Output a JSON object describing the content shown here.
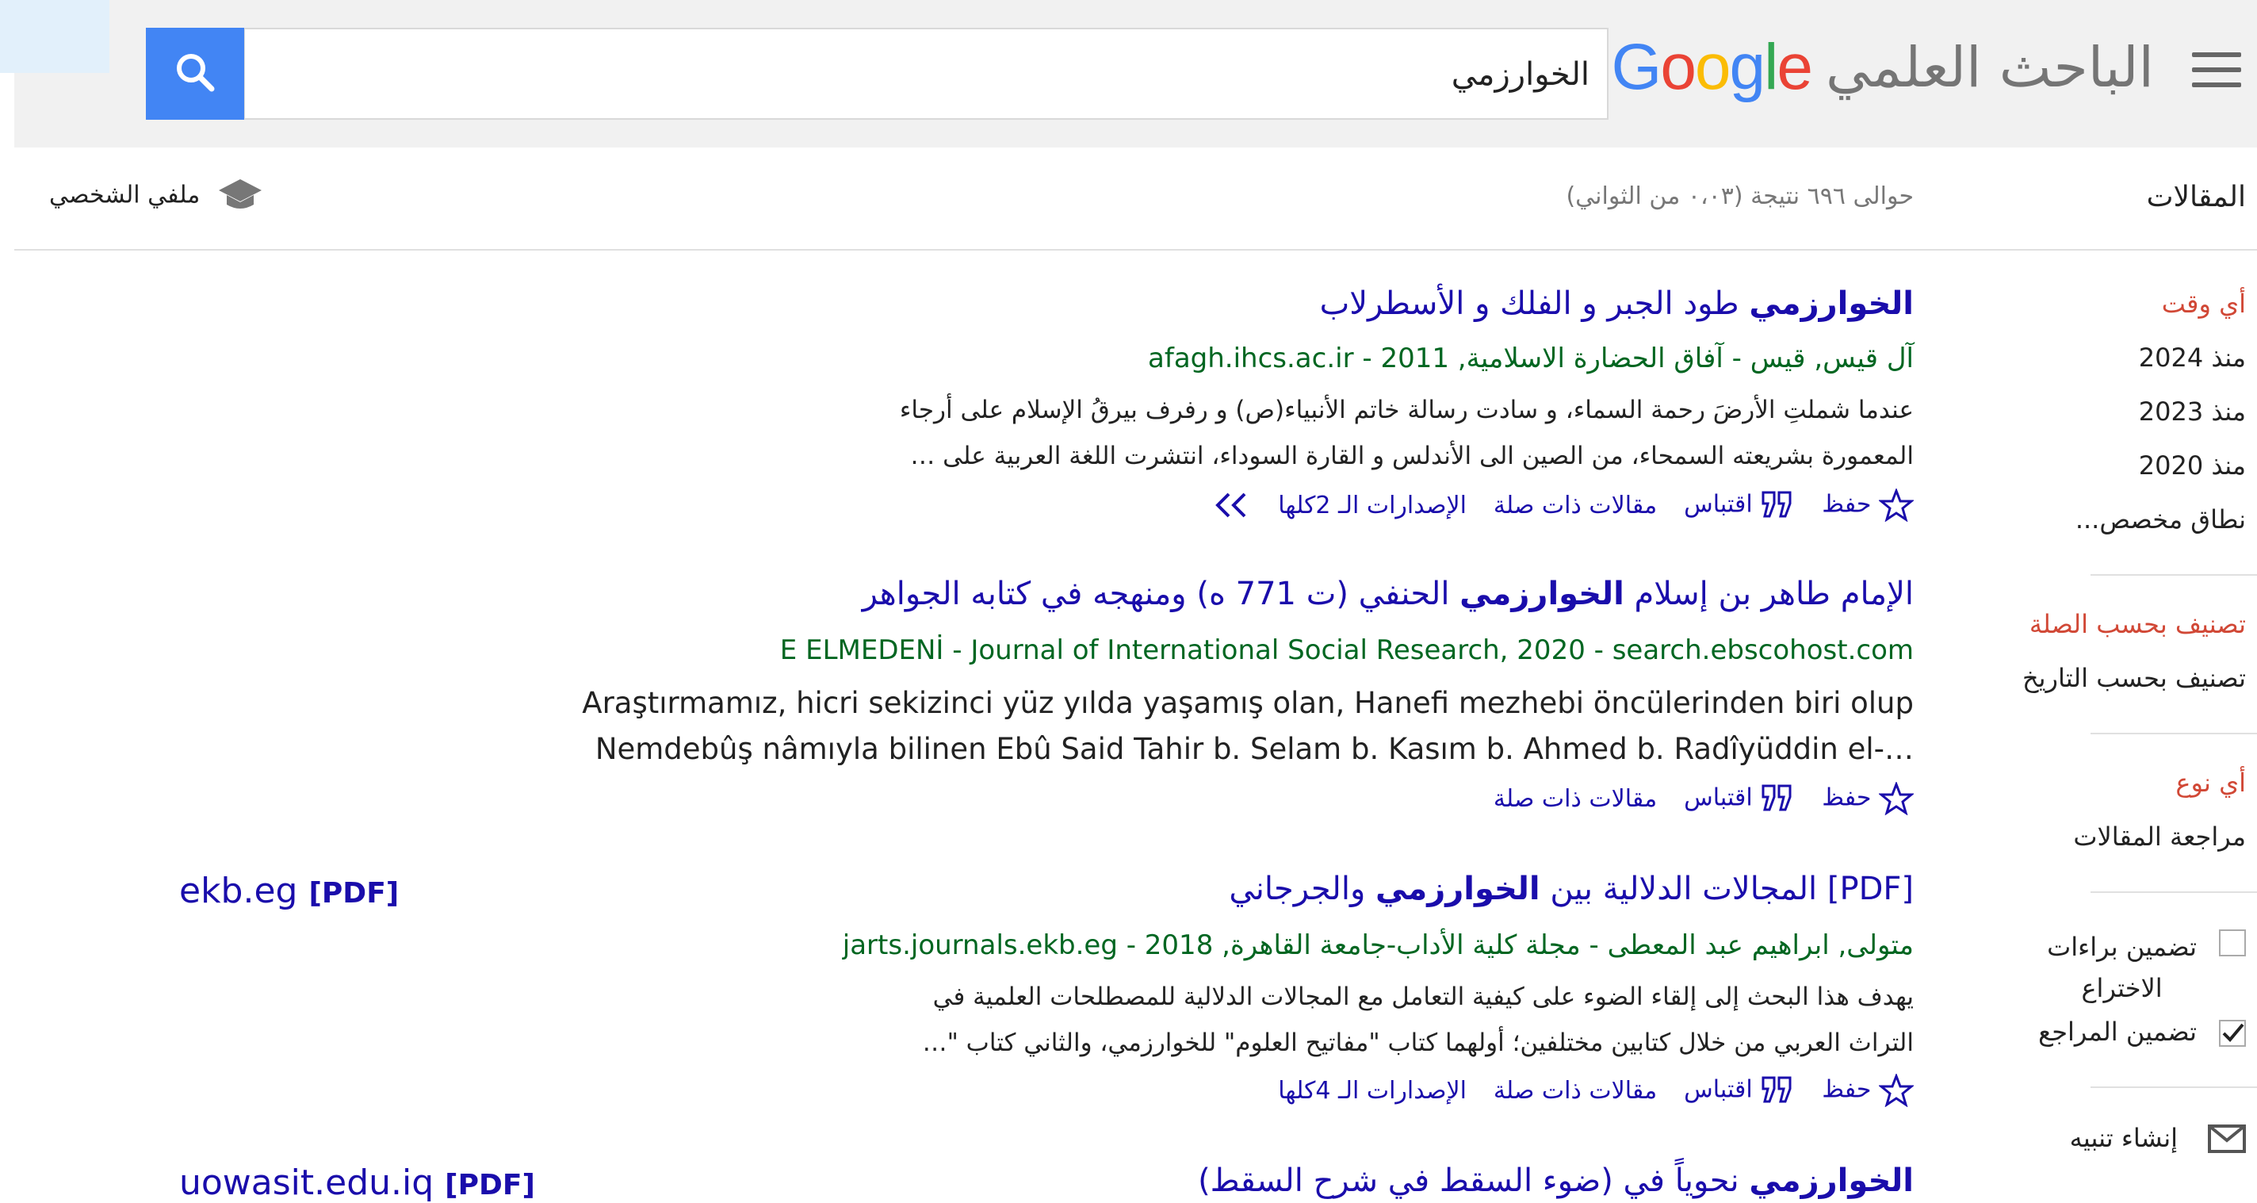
{
  "header": {
    "logo_google": "Google",
    "logo_scholar": "الباحث العلمي",
    "search_value": "الخوارزمي",
    "articles_label": "المقالات",
    "results_count": "حوالى ٦٩٦ نتيجة (٠،٠٣ من الثواني)",
    "profile_label": "ملفي الشخصي"
  },
  "sidebar": {
    "time_any": "أي وقت",
    "time_2024": "منذ 2024",
    "time_2023": "منذ 2023",
    "time_2020": "منذ 2020",
    "time_custom": "نطاق مخصص...",
    "sort_relevance": "تصنيف بحسب الصلة",
    "sort_date": "تصنيف بحسب التاريخ",
    "type_any": "أي نوع",
    "type_review": "مراجعة المقالات",
    "patents_line1": "تضمين براءات",
    "patents_line2": "الاختراع",
    "citations": "تضمين المراجع",
    "alert": "إنشاء تنبيه"
  },
  "results": [
    {
      "title_bold": "الخوارزمي",
      "title_rest": " طود الجبر و الفلك و الأسطرلاب",
      "source": "آل قيس, قيس - آفاق الحضارة الاسلامية, 2011 - afagh.ihcs.ac.ir",
      "snippet1": "عندما شملتِ الأرضَ رحمة السماء، و سادت رسالة خاتم الأنبياء(ص) و رفرف بيرقُ الإسلام على أرجاء",
      "snippet2": "المعمورة بشريعته السمحاء، من الصين الى الأندلس و القارة السوداء، انتشرت اللغة العربية على …",
      "save": "حفظ",
      "cite": "اقتباس",
      "related": "مقالات ذات صلة",
      "versions": "الإصدارات الـ 2كلها"
    },
    {
      "title_prefix": "الإمام طاهر بن إسلام ",
      "title_bold": "الخوارزمي",
      "title_rest": " الحنفي (ت 771 ه) ومنهجه في كتابه الجواهر",
      "source": "E ELMEDENİ - Journal of International Social Research, 2020 - search.ebscohost.com",
      "snippet1": "Araştırmamız, hicri sekizinci yüz yılda yaşamış olan, Hanefi mezhebi öncülerinden biri olup",
      "snippet2": "Nemdebûş nâmıyla bilinen Ebû Said Tahir b. Selam b. Kasım b. Ahmed b. Radîyüddin el-…",
      "save": "حفظ",
      "cite": "اقتباس",
      "related": "مقالات ذات صلة"
    },
    {
      "pdf_tag": "[PDF]",
      "title_prefix": " المجالات الدلالية بين ",
      "title_bold": "الخوارزمي",
      "title_rest": " والجرجاني",
      "source": "متولى, ابراهيم عبد المعطى - مجلة كلية الأداب-جامعة القاهرة, 2018 - jarts.journals.ekb.eg",
      "snippet1": "يهدف هذا البحث إلى إلقاء الضوء على كيفية التعامل مع المجالات الدلالية للمصطلحات العلمية في",
      "snippet2": "التراث العربي من خلال كتابين مختلفين؛ أولهما كتاب \"مفاتيح العلوم\" للخوارزمي، والثاني كتاب \"…",
      "save": "حفظ",
      "cite": "اقتباس",
      "related": "مقالات ذات صلة",
      "versions": "الإصدارات الـ 4كلها",
      "side_pdf": "[PDF]",
      "side_domain": "ekb.eg"
    },
    {
      "title_bold": "الخوارزمي",
      "title_rest": " نحوياً في (ضوء السقط في شرح السقط)",
      "side_pdf": "[PDF]",
      "side_domain": "uowasit.edu.iq"
    }
  ],
  "colors": {
    "google_blue": "#4285f4",
    "google_red": "#ea4335",
    "google_yellow": "#fbbc05",
    "google_green": "#34a853",
    "link": "#1a0dab",
    "source_green": "#006621",
    "sidebar_red": "#d14836"
  }
}
